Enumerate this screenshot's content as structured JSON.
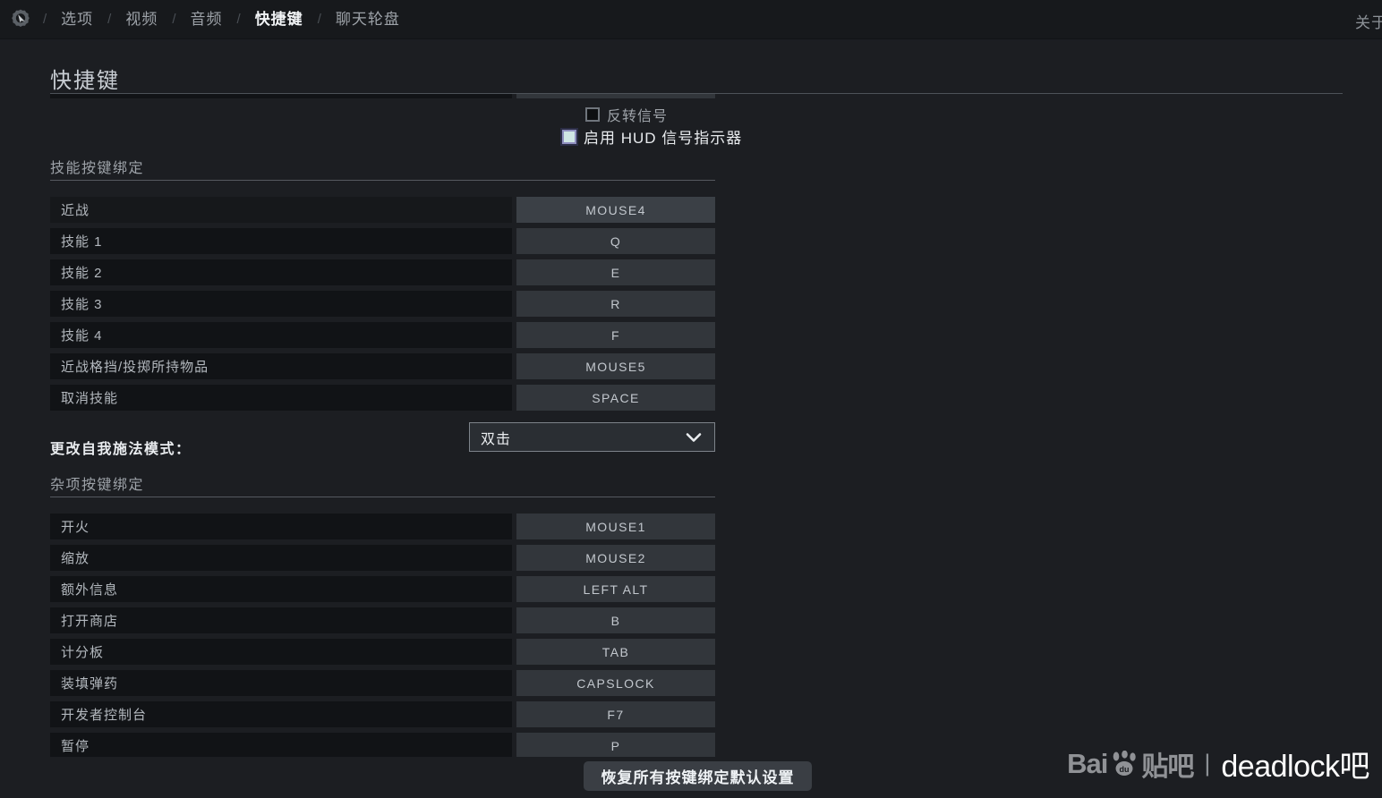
{
  "topbar": {
    "gear_icon": "gear-cursor-icon",
    "separator": "/",
    "tabs": [
      {
        "label": "选项",
        "active": false
      },
      {
        "label": "视频",
        "active": false
      },
      {
        "label": "音频",
        "active": false
      },
      {
        "label": "快捷键",
        "active": true
      },
      {
        "label": "聊天轮盘",
        "active": false
      }
    ],
    "about_label": "关于"
  },
  "page": {
    "title": "快捷键"
  },
  "clipped_top_row": {
    "label": "",
    "key": ""
  },
  "checkboxes": [
    {
      "label": "反转信号",
      "checked": false
    },
    {
      "label": "启用 HUD 信号指示器",
      "checked": true
    }
  ],
  "sections": [
    {
      "title": "技能按键绑定",
      "rows": [
        {
          "label": "近战",
          "key": "MOUSE4",
          "highlighted": true
        },
        {
          "label": "技能 1",
          "key": "Q",
          "highlighted": false
        },
        {
          "label": "技能 2",
          "key": "E",
          "highlighted": false
        },
        {
          "label": "技能 3",
          "key": "R",
          "highlighted": false
        },
        {
          "label": "技能 4",
          "key": "F",
          "highlighted": false
        },
        {
          "label": "近战格挡/投掷所持物品",
          "key": "MOUSE5",
          "highlighted": false
        },
        {
          "label": "取消技能",
          "key": "SPACE",
          "highlighted": false
        }
      ]
    },
    {
      "title": "杂项按键绑定",
      "rows": [
        {
          "label": "开火",
          "key": "MOUSE1",
          "highlighted": false
        },
        {
          "label": "缩放",
          "key": "MOUSE2",
          "highlighted": false
        },
        {
          "label": "额外信息",
          "key": "LEFT ALT",
          "highlighted": false
        },
        {
          "label": "打开商店",
          "key": "B",
          "highlighted": false
        },
        {
          "label": "计分板",
          "key": "TAB",
          "highlighted": false
        },
        {
          "label": "装填弹药",
          "key": "CAPSLOCK",
          "highlighted": false
        },
        {
          "label": "开发者控制台",
          "key": "F7",
          "highlighted": false
        },
        {
          "label": "暂停",
          "key": "P",
          "highlighted": false
        }
      ]
    }
  ],
  "selfcast": {
    "label": "更改自我施法模式：",
    "value": "双击",
    "chevron_icon": "chevron-down-icon"
  },
  "footer": {
    "reset_label": "恢复所有按键绑定默认设置"
  },
  "watermark": {
    "bai": "Bai",
    "paw_icon": "baidu-paw-icon",
    "tieba": "贴吧",
    "pipe": "|",
    "forum": "deadlock吧"
  },
  "colors": {
    "background": "#1c1e22",
    "topbar": "#17191c",
    "row_label_bg": "#111316",
    "key_button_bg": "#32363b",
    "accent_checked": "#cfe6e4",
    "text_primary": "#e9ecef",
    "text_secondary": "#9da2a8"
  }
}
